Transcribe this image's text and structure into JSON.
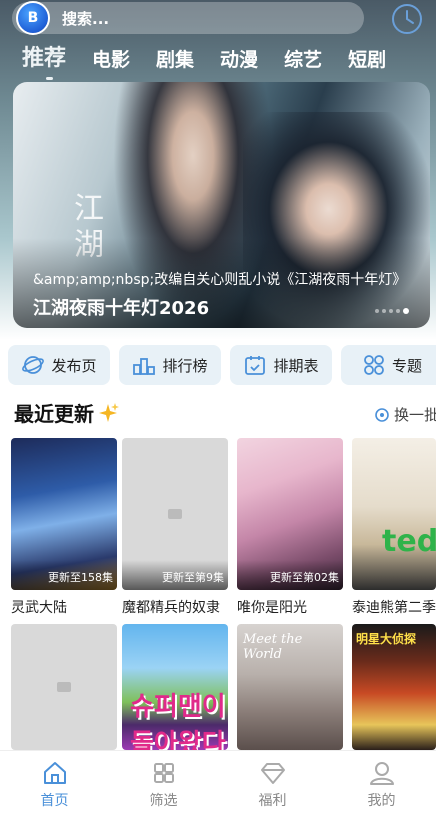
{
  "header": {
    "search_placeholder": "搜索...",
    "logo_text": "B",
    "categories": [
      {
        "label": "推荐",
        "active": true
      },
      {
        "label": "电影",
        "active": false
      },
      {
        "label": "剧集",
        "active": false
      },
      {
        "label": "动漫",
        "active": false
      },
      {
        "label": "综艺",
        "active": false
      },
      {
        "label": "短剧",
        "active": false
      }
    ]
  },
  "banner": {
    "calligraphy": "江湖",
    "description": "&amp;amp;nbsp;改编自关心则乱小说《江湖夜雨十年灯》",
    "title": "江湖夜雨十年灯2026",
    "dot_count": 5,
    "active_dot": 4
  },
  "quick_nav": [
    {
      "label": "发布页",
      "icon": "planet-icon"
    },
    {
      "label": "排行榜",
      "icon": "podium-icon"
    },
    {
      "label": "排期表",
      "icon": "calendar-icon"
    },
    {
      "label": "专题",
      "icon": "grid-icon"
    }
  ],
  "recent": {
    "title": "最近更新",
    "refresh_label": "换一批",
    "row1": [
      {
        "title": "灵武大陆",
        "badge": "更新至158集"
      },
      {
        "title": "魔都精兵的奴隶",
        "badge": "更新至第9集"
      },
      {
        "title": "唯你是阳光",
        "badge": "更新至第02集"
      },
      {
        "title": "泰迪熊第二季",
        "badge": "",
        "poster_text": "ted"
      }
    ],
    "row2": [
      {
        "title": "",
        "badge": ""
      },
      {
        "title": "",
        "badge": "",
        "poster_text": "슈퍼맨이 돌아왔다"
      },
      {
        "title": "",
        "badge": "",
        "poster_text": "Meet the World"
      },
      {
        "title": "",
        "badge": "",
        "poster_text": "明星大侦探"
      }
    ]
  },
  "bottom_nav": [
    {
      "label": "首页",
      "active": true
    },
    {
      "label": "筛选",
      "active": false
    },
    {
      "label": "福利",
      "active": false
    },
    {
      "label": "我的",
      "active": false
    }
  ],
  "colors": {
    "accent": "#4a90d9",
    "quick_nav_bg": "#e8f1f7"
  }
}
